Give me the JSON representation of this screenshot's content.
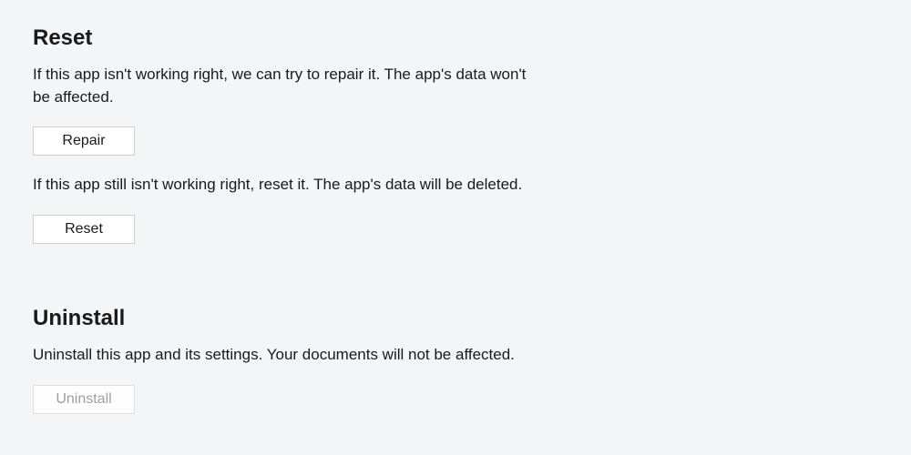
{
  "reset": {
    "heading": "Reset",
    "repair_description": "If this app isn't working right, we can try to repair it. The app's data won't be affected.",
    "repair_button": "Repair",
    "reset_description": "If this app still isn't working right, reset it. The app's data will be deleted.",
    "reset_button": "Reset"
  },
  "uninstall": {
    "heading": "Uninstall",
    "description": "Uninstall this app and its settings. Your documents will not be affected.",
    "uninstall_button": "Uninstall"
  }
}
